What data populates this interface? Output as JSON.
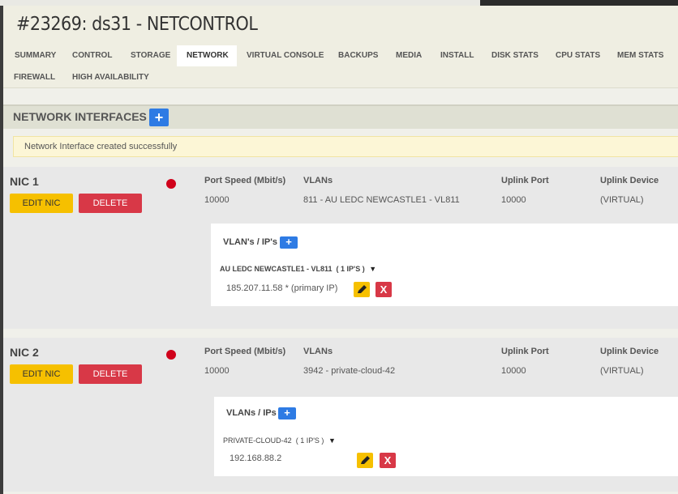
{
  "page": {
    "title": "#23269: ds31 - NETCONTROL"
  },
  "tabs": [
    {
      "label": "SUMMARY"
    },
    {
      "label": "CONTROL"
    },
    {
      "label": "STORAGE"
    },
    {
      "label": "NETWORK"
    },
    {
      "label": "VIRTUAL CONSOLE"
    },
    {
      "label": "BACKUPS"
    },
    {
      "label": "MEDIA"
    },
    {
      "label": "INSTALL"
    },
    {
      "label": "DISK STATS"
    },
    {
      "label": "CPU STATS"
    },
    {
      "label": "MEM STATS"
    },
    {
      "label": "FIREWALL"
    },
    {
      "label": "HIGH AVAILABILITY"
    }
  ],
  "active_tab": "NETWORK",
  "section": {
    "title": "NETWORK INTERFACES",
    "add_label": "+"
  },
  "alert": {
    "message": "Network Interface created successfully"
  },
  "columns": {
    "port_speed": "Port Speed (Mbit/s)",
    "vlans": "VLANs",
    "uplink_port": "Uplink Port",
    "uplink_device": "Uplink Device"
  },
  "nics": [
    {
      "name": "NIC 1",
      "edit_label": "EDIT NIC",
      "delete_label": "DELETE",
      "port_speed": "10000",
      "vlan": "811 - AU LEDC NEWCASTLE1 - VL811",
      "uplink_port": "10000",
      "uplink_device": "(VIRTUAL)",
      "vlans_title": "VLAN's / IP's",
      "vlan_group": "AU LEDC NEWCASTLE1 - VL811",
      "ip_count": "( 1 IP'S )",
      "ip": "185.207.11.58 * (primary IP)",
      "delete_glyph": "X"
    },
    {
      "name": "NIC 2",
      "edit_label": "EDIT NIC",
      "delete_label": "DELETE",
      "port_speed": "10000",
      "vlan": "3942 - private-cloud-42",
      "uplink_port": "10000",
      "uplink_device": "(VIRTUAL)",
      "vlans_title": "VLANs / IPs",
      "vlan_group": "PRIVATE-CLOUD-42",
      "ip_count": "( 1 IP'S )",
      "ip": "192.168.88.2",
      "delete_glyph": "X"
    }
  ],
  "colors": {
    "accent_blue": "#2e7be4",
    "edit_yellow": "#f6c000",
    "delete_red": "#d83847",
    "status_red": "#d0021b"
  },
  "icons": {
    "caret": "▼",
    "edit": "pencil-icon",
    "add": "plus-icon"
  }
}
